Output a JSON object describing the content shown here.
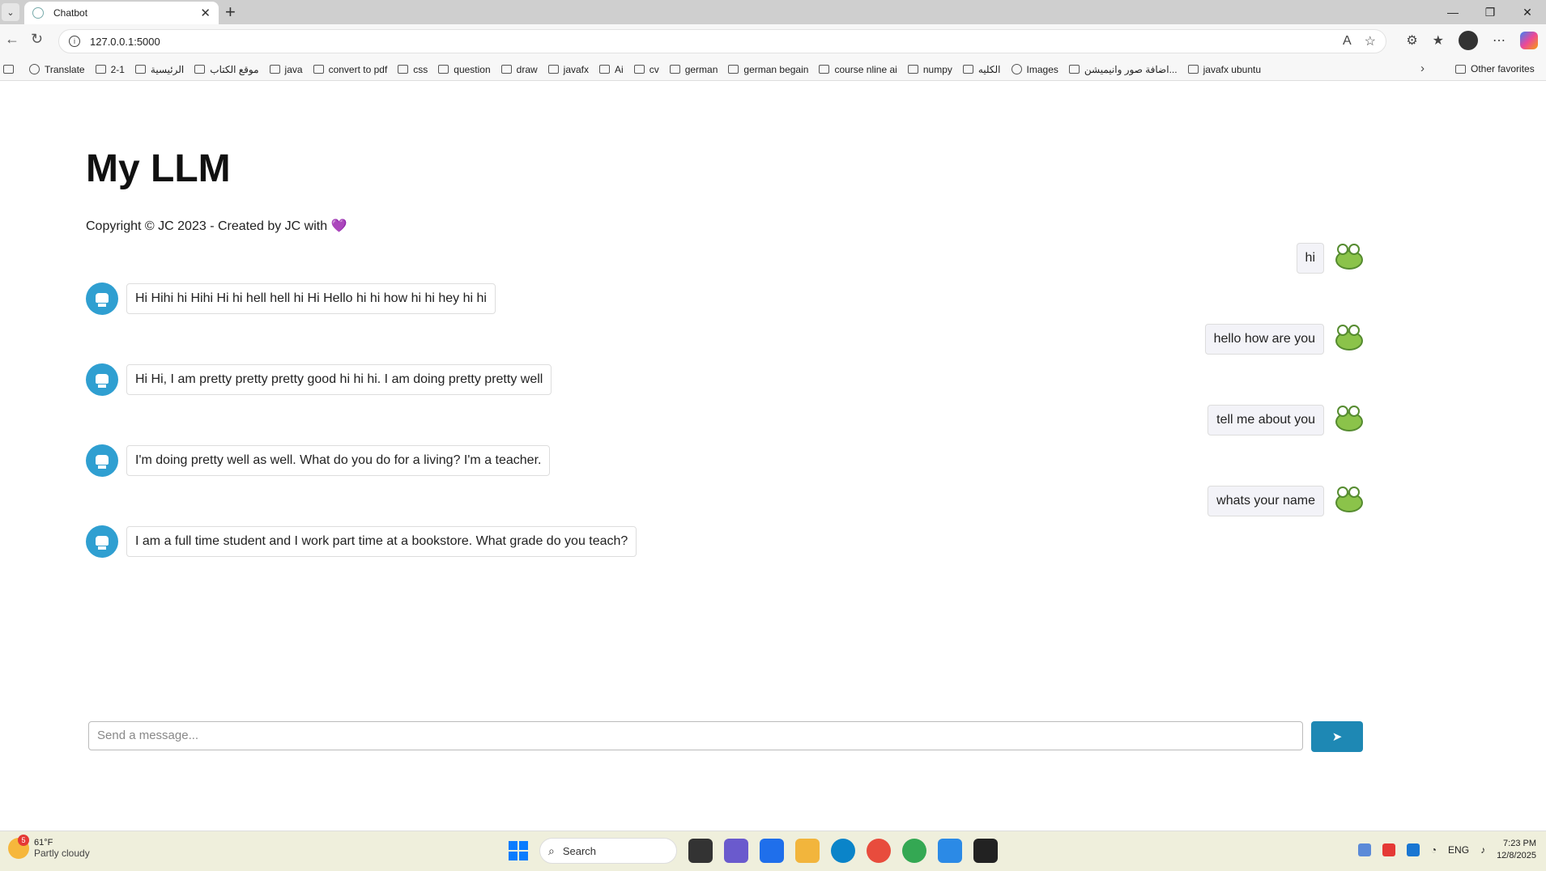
{
  "browser": {
    "tab_title": "Chatbot",
    "url": "127.0.0.1:5000",
    "bookmarks": [
      "Translate",
      "2-1",
      "الرئيسية",
      "موقع الكتاب",
      "java",
      "convert to pdf",
      "css",
      "question",
      "draw",
      "javafx",
      "Ai",
      "cv",
      "german",
      "german begain",
      "course nline ai",
      "numpy",
      "الكليه",
      "Images",
      "اضافة صور وانيميشن...",
      "javafx ubuntu"
    ],
    "other_favorites": "Other favorites"
  },
  "page": {
    "title": "My LLM",
    "copyright": "Copyright © JC 2023 - Created by JC with",
    "heart": "💜"
  },
  "chat": {
    "messages": [
      {
        "role": "user",
        "text": "hi"
      },
      {
        "role": "bot",
        "text": "Hi Hihi hi Hihi Hi hi hell hell hi Hi Hello hi hi how hi hi hey hi hi"
      },
      {
        "role": "user",
        "text": "hello how are you"
      },
      {
        "role": "bot",
        "text": "Hi Hi, I am pretty pretty pretty good hi hi hi. I am doing pretty pretty well"
      },
      {
        "role": "user",
        "text": "tell me about you"
      },
      {
        "role": "bot",
        "text": "I'm doing pretty well as well. What do you do for a living? I'm a teacher."
      },
      {
        "role": "user",
        "text": "whats your name"
      },
      {
        "role": "bot",
        "text": "I am a full time student and I work part time at a bookstore. What grade do you teach?"
      }
    ],
    "input_placeholder": "Send a message...",
    "send_label": "➤"
  },
  "taskbar": {
    "weather_temp": "61°F",
    "weather_desc": "Partly cloudy",
    "weather_badge": "5",
    "search_label": "Search",
    "lang": "ENG",
    "time": "7:23 PM",
    "date": "12/8/2025"
  }
}
